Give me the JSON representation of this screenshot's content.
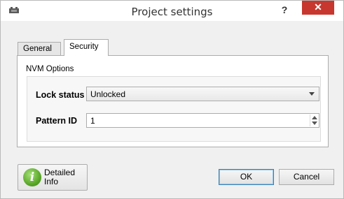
{
  "window": {
    "title": "Project settings",
    "help_label": "?",
    "close_label": "✕"
  },
  "tabs": [
    {
      "label": "General",
      "selected": false
    },
    {
      "label": "Security",
      "selected": true
    }
  ],
  "security": {
    "group_title": "NVM Options",
    "lock_status_label": "Lock status",
    "lock_status_value": "Unlocked",
    "pattern_id_label": "Pattern ID",
    "pattern_id_value": "1"
  },
  "footer": {
    "info_icon_glyph": "i",
    "info_line1": "Detailed",
    "info_line2": "Info",
    "ok_label": "OK",
    "cancel_label": "Cancel"
  },
  "colors": {
    "close_button": "#c7372f",
    "info_icon": "#5aa829",
    "default_button_border": "#3c7fb1"
  }
}
